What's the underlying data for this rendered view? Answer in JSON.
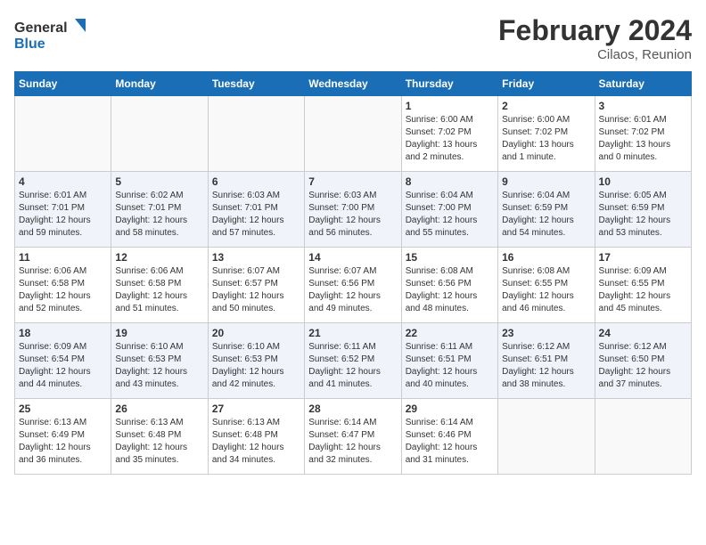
{
  "header": {
    "logo_line1": "General",
    "logo_line2": "Blue",
    "month_year": "February 2024",
    "location": "Cilaos, Reunion"
  },
  "days_of_week": [
    "Sunday",
    "Monday",
    "Tuesday",
    "Wednesday",
    "Thursday",
    "Friday",
    "Saturday"
  ],
  "weeks": [
    [
      {
        "day": "",
        "info": []
      },
      {
        "day": "",
        "info": []
      },
      {
        "day": "",
        "info": []
      },
      {
        "day": "",
        "info": []
      },
      {
        "day": "1",
        "info": [
          "Sunrise: 6:00 AM",
          "Sunset: 7:02 PM",
          "Daylight: 13 hours",
          "and 2 minutes."
        ]
      },
      {
        "day": "2",
        "info": [
          "Sunrise: 6:00 AM",
          "Sunset: 7:02 PM",
          "Daylight: 13 hours",
          "and 1 minute."
        ]
      },
      {
        "day": "3",
        "info": [
          "Sunrise: 6:01 AM",
          "Sunset: 7:02 PM",
          "Daylight: 13 hours",
          "and 0 minutes."
        ]
      }
    ],
    [
      {
        "day": "4",
        "info": [
          "Sunrise: 6:01 AM",
          "Sunset: 7:01 PM",
          "Daylight: 12 hours",
          "and 59 minutes."
        ]
      },
      {
        "day": "5",
        "info": [
          "Sunrise: 6:02 AM",
          "Sunset: 7:01 PM",
          "Daylight: 12 hours",
          "and 58 minutes."
        ]
      },
      {
        "day": "6",
        "info": [
          "Sunrise: 6:03 AM",
          "Sunset: 7:01 PM",
          "Daylight: 12 hours",
          "and 57 minutes."
        ]
      },
      {
        "day": "7",
        "info": [
          "Sunrise: 6:03 AM",
          "Sunset: 7:00 PM",
          "Daylight: 12 hours",
          "and 56 minutes."
        ]
      },
      {
        "day": "8",
        "info": [
          "Sunrise: 6:04 AM",
          "Sunset: 7:00 PM",
          "Daylight: 12 hours",
          "and 55 minutes."
        ]
      },
      {
        "day": "9",
        "info": [
          "Sunrise: 6:04 AM",
          "Sunset: 6:59 PM",
          "Daylight: 12 hours",
          "and 54 minutes."
        ]
      },
      {
        "day": "10",
        "info": [
          "Sunrise: 6:05 AM",
          "Sunset: 6:59 PM",
          "Daylight: 12 hours",
          "and 53 minutes."
        ]
      }
    ],
    [
      {
        "day": "11",
        "info": [
          "Sunrise: 6:06 AM",
          "Sunset: 6:58 PM",
          "Daylight: 12 hours",
          "and 52 minutes."
        ]
      },
      {
        "day": "12",
        "info": [
          "Sunrise: 6:06 AM",
          "Sunset: 6:58 PM",
          "Daylight: 12 hours",
          "and 51 minutes."
        ]
      },
      {
        "day": "13",
        "info": [
          "Sunrise: 6:07 AM",
          "Sunset: 6:57 PM",
          "Daylight: 12 hours",
          "and 50 minutes."
        ]
      },
      {
        "day": "14",
        "info": [
          "Sunrise: 6:07 AM",
          "Sunset: 6:56 PM",
          "Daylight: 12 hours",
          "and 49 minutes."
        ]
      },
      {
        "day": "15",
        "info": [
          "Sunrise: 6:08 AM",
          "Sunset: 6:56 PM",
          "Daylight: 12 hours",
          "and 48 minutes."
        ]
      },
      {
        "day": "16",
        "info": [
          "Sunrise: 6:08 AM",
          "Sunset: 6:55 PM",
          "Daylight: 12 hours",
          "and 46 minutes."
        ]
      },
      {
        "day": "17",
        "info": [
          "Sunrise: 6:09 AM",
          "Sunset: 6:55 PM",
          "Daylight: 12 hours",
          "and 45 minutes."
        ]
      }
    ],
    [
      {
        "day": "18",
        "info": [
          "Sunrise: 6:09 AM",
          "Sunset: 6:54 PM",
          "Daylight: 12 hours",
          "and 44 minutes."
        ]
      },
      {
        "day": "19",
        "info": [
          "Sunrise: 6:10 AM",
          "Sunset: 6:53 PM",
          "Daylight: 12 hours",
          "and 43 minutes."
        ]
      },
      {
        "day": "20",
        "info": [
          "Sunrise: 6:10 AM",
          "Sunset: 6:53 PM",
          "Daylight: 12 hours",
          "and 42 minutes."
        ]
      },
      {
        "day": "21",
        "info": [
          "Sunrise: 6:11 AM",
          "Sunset: 6:52 PM",
          "Daylight: 12 hours",
          "and 41 minutes."
        ]
      },
      {
        "day": "22",
        "info": [
          "Sunrise: 6:11 AM",
          "Sunset: 6:51 PM",
          "Daylight: 12 hours",
          "and 40 minutes."
        ]
      },
      {
        "day": "23",
        "info": [
          "Sunrise: 6:12 AM",
          "Sunset: 6:51 PM",
          "Daylight: 12 hours",
          "and 38 minutes."
        ]
      },
      {
        "day": "24",
        "info": [
          "Sunrise: 6:12 AM",
          "Sunset: 6:50 PM",
          "Daylight: 12 hours",
          "and 37 minutes."
        ]
      }
    ],
    [
      {
        "day": "25",
        "info": [
          "Sunrise: 6:13 AM",
          "Sunset: 6:49 PM",
          "Daylight: 12 hours",
          "and 36 minutes."
        ]
      },
      {
        "day": "26",
        "info": [
          "Sunrise: 6:13 AM",
          "Sunset: 6:48 PM",
          "Daylight: 12 hours",
          "and 35 minutes."
        ]
      },
      {
        "day": "27",
        "info": [
          "Sunrise: 6:13 AM",
          "Sunset: 6:48 PM",
          "Daylight: 12 hours",
          "and 34 minutes."
        ]
      },
      {
        "day": "28",
        "info": [
          "Sunrise: 6:14 AM",
          "Sunset: 6:47 PM",
          "Daylight: 12 hours",
          "and 32 minutes."
        ]
      },
      {
        "day": "29",
        "info": [
          "Sunrise: 6:14 AM",
          "Sunset: 6:46 PM",
          "Daylight: 12 hours",
          "and 31 minutes."
        ]
      },
      {
        "day": "",
        "info": []
      },
      {
        "day": "",
        "info": []
      }
    ]
  ]
}
